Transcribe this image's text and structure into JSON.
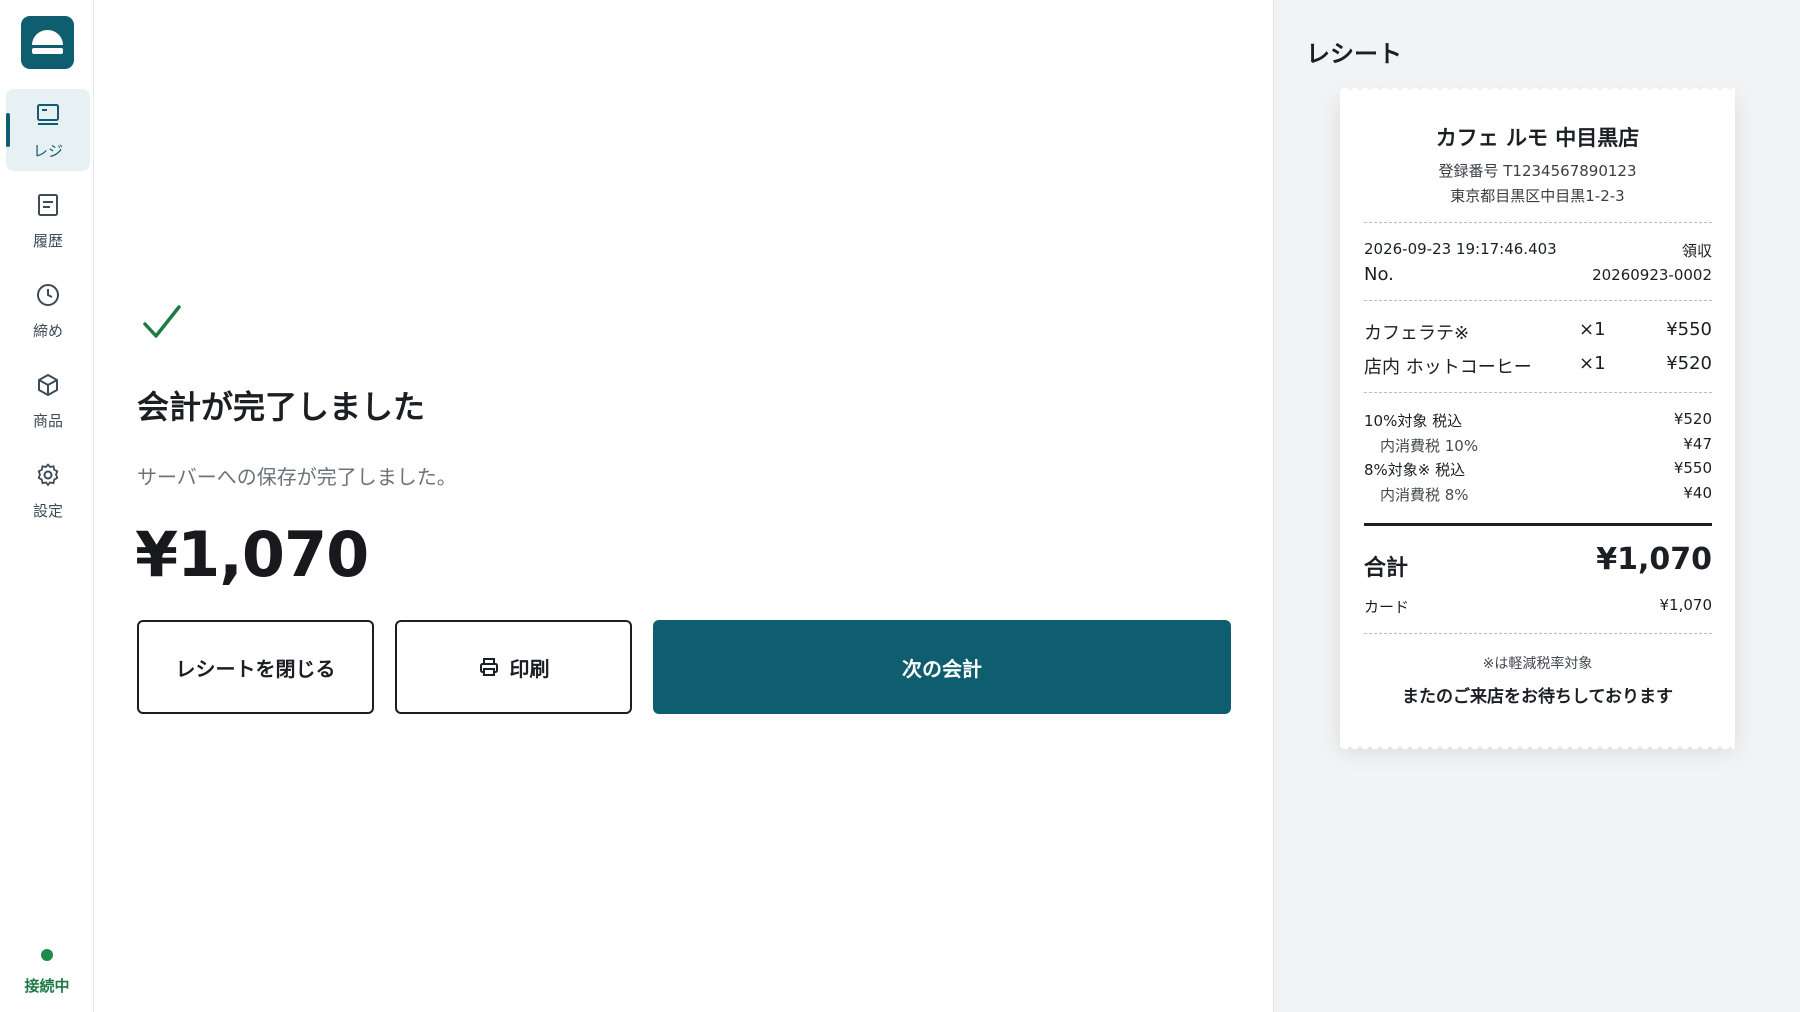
{
  "sidebar": {
    "items": [
      {
        "label": "レジ",
        "icon": "register-icon",
        "active": true
      },
      {
        "label": "履歴",
        "icon": "history-icon"
      },
      {
        "label": "締め",
        "icon": "clock-icon"
      },
      {
        "label": "商品",
        "icon": "box-icon"
      },
      {
        "label": "設定",
        "icon": "gear-icon"
      }
    ],
    "status": "接続中"
  },
  "main": {
    "title": "会計が完了しました",
    "subtitle": "サーバーへの保存が完了しました。",
    "amount": "¥1,070",
    "buttons": {
      "close": "レシートを閉じる",
      "print": "印刷",
      "next": "次の会計"
    }
  },
  "receipt": {
    "panel_title": "レシート",
    "store_name": "カフェ ルモ 中目黒店",
    "registration": "登録番号 T1234567890123",
    "address": "東京都目黒区中目黒1-2-3",
    "datetime": "2026-09-23 19:17:46.403",
    "type": "領収",
    "no_label": "No.",
    "no_value": "20260923-0002",
    "items": [
      {
        "name": "カフェラテ※",
        "qty": "×1",
        "price": "¥550"
      },
      {
        "name": "店内 ホットコーヒー",
        "qty": "×1",
        "price": "¥520"
      }
    ],
    "tax": [
      {
        "label": "10%対象 税込",
        "value": "¥520"
      },
      {
        "label": "内消費税 10%",
        "value": "¥47"
      },
      {
        "label": "8%対象※ 税込",
        "value": "¥550"
      },
      {
        "label": "内消費税 8%",
        "value": "¥40"
      }
    ],
    "total_label": "合計",
    "total_value": "¥1,070",
    "payment_label": "カード",
    "payment_value": "¥1,070",
    "note": "※は軽減税率対象",
    "thanks": "またのご来店をお待ちしております"
  },
  "colors": {
    "brand": "#0f5e6f",
    "status_green": "#1f8a4c",
    "check_green": "#1f7a45"
  }
}
